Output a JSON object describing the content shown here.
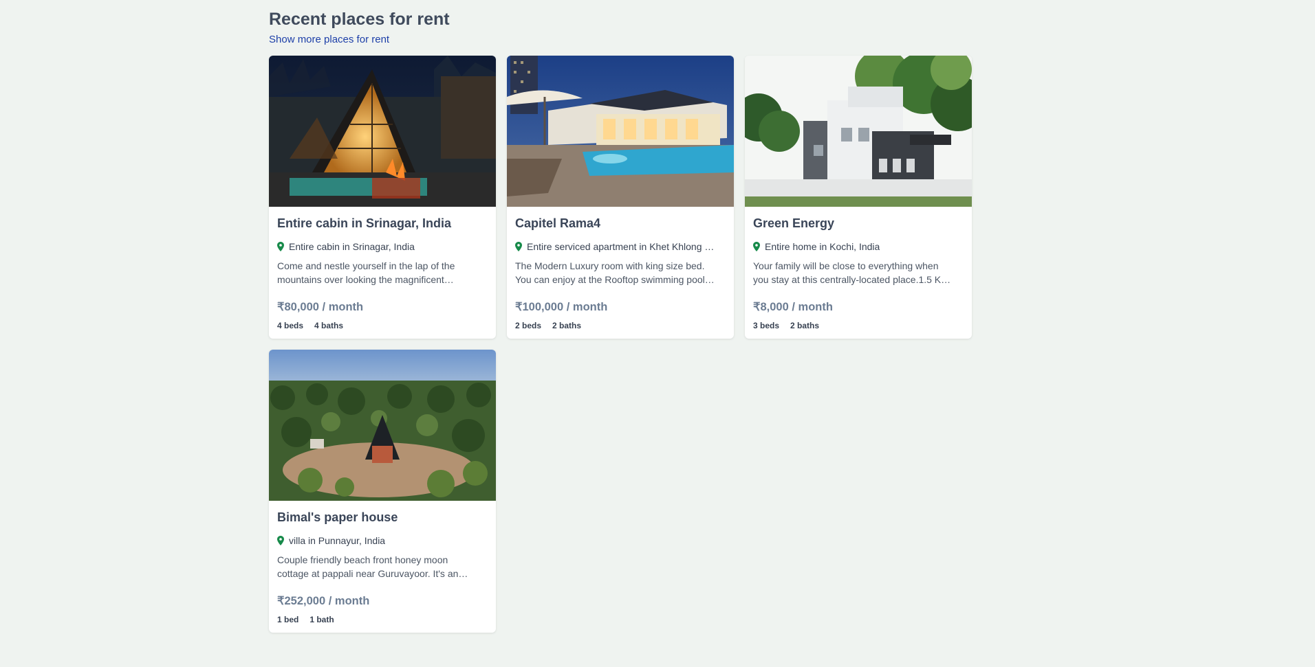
{
  "section": {
    "title": "Recent places for rent",
    "more_link": "Show more places for rent"
  },
  "colors": {
    "background": "#eff3f0",
    "title": "#3f4a5c",
    "link": "#1d3fa8",
    "price": "#6b7c92",
    "pin": "#178a4a"
  },
  "listings": [
    {
      "title": "Entire cabin in Srinagar, India",
      "location": "Entire cabin in Srinagar, India",
      "description": "Come and nestle yourself in the lap of the mountains over looking the magnificent…",
      "price": "₹80,000 / month",
      "beds": "4 beds",
      "baths": "4 baths",
      "image": "a-frame-cabin-night-photo"
    },
    {
      "title": "Capitel Rama4",
      "location": "Entire serviced apartment in Khet Khlong …",
      "description": "The Modern Luxury room with king size bed. You can enjoy at the Rooftop swimming pool…",
      "price": "₹100,000 / month",
      "beds": "2 beds",
      "baths": "2 baths",
      "image": "villa-pool-dusk-photo"
    },
    {
      "title": "Green Energy",
      "location": "Entire home in Kochi, India",
      "description": "Your family will be close to everything when you stay at this centrally-located place.1.5 K…",
      "price": "₹8,000 / month",
      "beds": "3 beds",
      "baths": "2 baths",
      "image": "modern-white-house-photo"
    },
    {
      "title": "Bimal's paper house",
      "location": "villa in Punnayur, India",
      "description": "Couple friendly beach front honey moon cottage at pappali near Guruvayoor. It's an…",
      "price": "₹252,000 / month",
      "beds": "1 bed",
      "baths": "1 bath",
      "image": "aerial-palm-house-photo"
    }
  ]
}
